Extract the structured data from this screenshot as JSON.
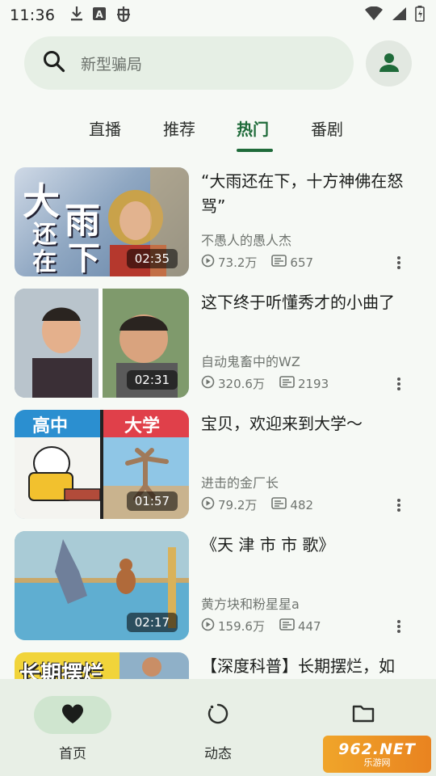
{
  "status_bar": {
    "time": "11:36",
    "left_icons": [
      "download-icon",
      "a-box-icon",
      "bug-icon"
    ],
    "right_icons": [
      "wifi-icon",
      "signal-icon",
      "battery-icon"
    ]
  },
  "search": {
    "placeholder": "新型骗局",
    "icon": "search-icon"
  },
  "avatar_icon": "person-icon",
  "tabs": [
    {
      "label": "直播",
      "active": false
    },
    {
      "label": "推荐",
      "active": false
    },
    {
      "label": "热门",
      "active": true
    },
    {
      "label": "番剧",
      "active": false
    }
  ],
  "videos": [
    {
      "title": "“大雨还在下，十方神佛在怒骂”",
      "author": "不愚人的愚人杰",
      "views": "73.2万",
      "danmaku": "657",
      "duration": "02:35",
      "thumb_text": [
        "大",
        "雨",
        "还",
        "在",
        "下"
      ]
    },
    {
      "title": "这下终于听懂秀才的小曲了",
      "author": "自动鬼畜中的WZ",
      "views": "320.6万",
      "danmaku": "2193",
      "duration": "02:31"
    },
    {
      "title": "宝贝，欢迎来到大学～",
      "author": "进击的金厂长",
      "views": "79.2万",
      "danmaku": "482",
      "duration": "01:57",
      "thumb_text": [
        "高中",
        "大学"
      ]
    },
    {
      "title": "《天 津 市 市 歌》",
      "author": "黄方块和粉星星a",
      "views": "159.6万",
      "danmaku": "447",
      "duration": "02:17"
    },
    {
      "title": "【深度科普】长期摆烂，如",
      "author": "",
      "views": "",
      "danmaku": "",
      "duration": "",
      "thumb_text": [
        "长期摆烂"
      ]
    }
  ],
  "bottom_nav": [
    {
      "label": "首页",
      "icon": "heart-icon",
      "active": true
    },
    {
      "label": "动态",
      "icon": "refresh-circle-icon",
      "active": false
    },
    {
      "label": "",
      "icon": "folder-icon",
      "active": false
    }
  ],
  "watermark": {
    "line1": "962.NET",
    "line2": "乐游网"
  },
  "colors": {
    "accent": "#1f6b3a",
    "background": "#f6f9f5",
    "search_bg": "#e6efe5",
    "nav_bg": "#e8efe6",
    "nav_active_pill": "#cfe5cf"
  }
}
